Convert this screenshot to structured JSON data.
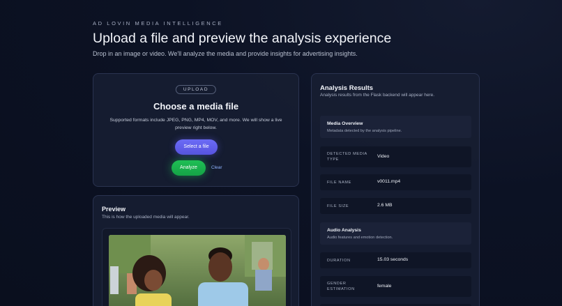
{
  "header": {
    "eyebrow": "AD LOVIN MEDIA INTELLIGENCE",
    "title": "Upload a file and preview the analysis experience",
    "subtitle": "Drop in an image or video. We'll analyze the media and provide insights for advertising insights."
  },
  "upload": {
    "pill": "UPLOAD",
    "title": "Choose a media file",
    "formats": "Supported formats include JPEG, PNG, MP4, MOV, and more. We will show a live preview right below.",
    "select_label": "Select a file",
    "analyze_label": "Analyze",
    "clear_label": "Clear"
  },
  "preview": {
    "title": "Preview",
    "subtitle": "This is how the uploaded media will appear."
  },
  "results": {
    "title": "Analysis Results",
    "subtitle": "Analysis results from the Flask backend will appear here.",
    "media_overview": {
      "title": "Media Overview",
      "subtitle": "Metadata detected by the analysis pipeline."
    },
    "detected_type": {
      "label": "DETECTED MEDIA TYPE",
      "value": "Video"
    },
    "file_name": {
      "label": "FILE NAME",
      "value": "v0011.mp4"
    },
    "file_size": {
      "label": "FILE SIZE",
      "value": "2.6 MB"
    },
    "audio": {
      "title": "Audio Analysis",
      "subtitle": "Audio features and emotion detection."
    },
    "duration": {
      "label": "DURATION",
      "value": "15.03 seconds"
    },
    "gender": {
      "label": "GENDER ESTIMATION",
      "value": "female"
    }
  },
  "colors": {
    "accent_purple": "#5d5ae6",
    "accent_green": "#1fbf55",
    "background": "#0c1224"
  }
}
